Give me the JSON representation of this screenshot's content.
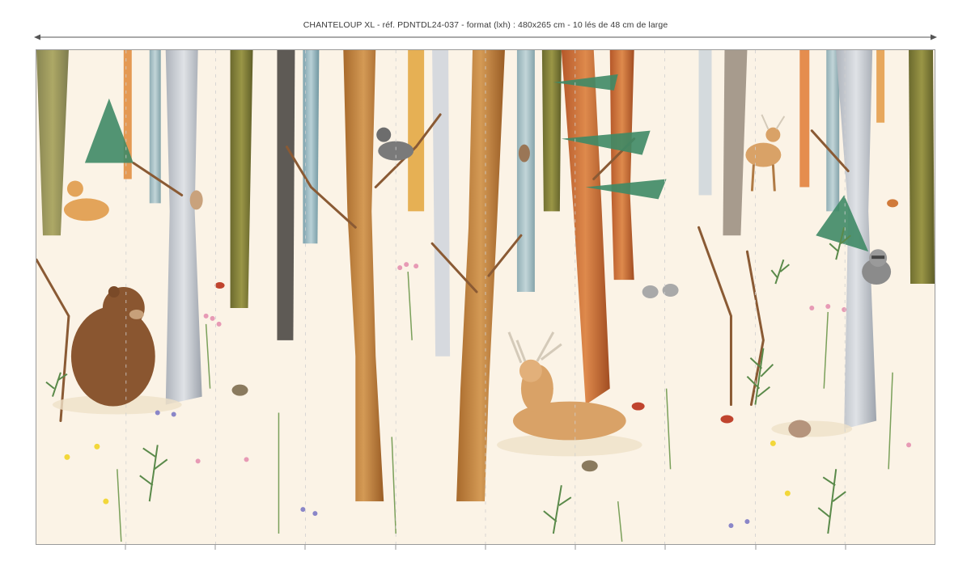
{
  "caption": "CHANTELOUP XL - réf. PDNTDL24-037 - format (lxh) : 480x265 cm - 10 lés de 48 cm de large",
  "colors": {
    "background": "#fbf3e6",
    "birch": "#c9cdd4",
    "oak": "#c98a43",
    "pine": "#3f8a66",
    "outline": "#8a8a8a"
  },
  "icons": {
    "arrow": "double-headed-arrow-icon"
  }
}
